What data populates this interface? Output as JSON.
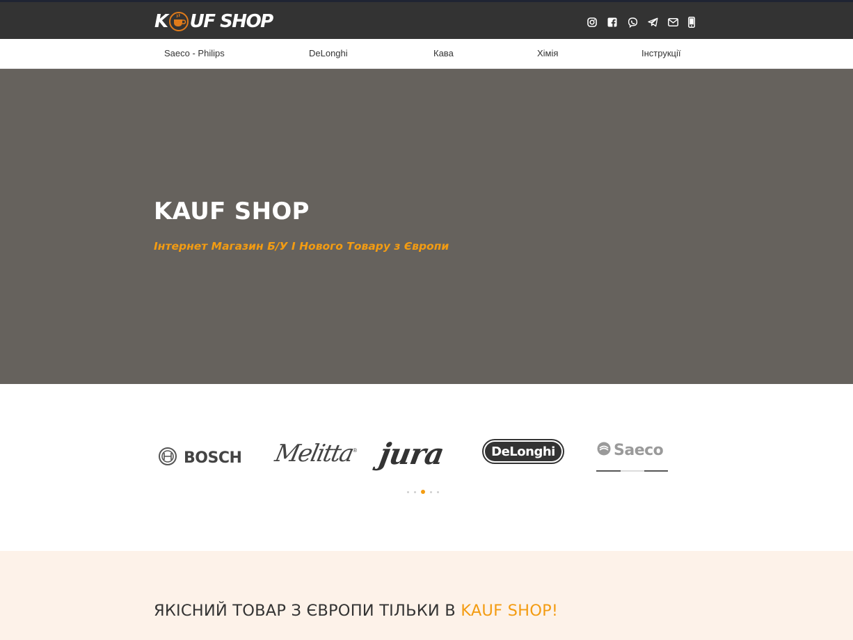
{
  "header": {
    "logo": {
      "part1": "K",
      "part2": "UF SHOP"
    },
    "socials": [
      {
        "name": "instagram-icon"
      },
      {
        "name": "facebook-icon"
      },
      {
        "name": "viber-icon"
      },
      {
        "name": "telegram-icon"
      },
      {
        "name": "email-icon"
      },
      {
        "name": "phone-icon"
      }
    ]
  },
  "nav": {
    "items": [
      "Saeco - Philips",
      "DeLonghi",
      "Кава",
      "Хімія",
      "Інструкції"
    ]
  },
  "hero": {
    "title": "KAUF SHOP",
    "subtitle": "Інтернет Магазин Б/У І Нового Товару з Європи"
  },
  "brands": {
    "logos": [
      "BOSCH",
      "Melitta",
      "jura",
      "DeLonghi",
      "Saeco"
    ],
    "carousel": {
      "total": 5,
      "active": 3
    }
  },
  "promo": {
    "title_prefix": "ЯКІСНИЙ ТОВАР З ЄВРОПИ ТІЛЬКИ В ",
    "title_accent": "KAUF SHOP!"
  },
  "colors": {
    "accent": "#f39c12",
    "topbar": "#333333",
    "hero_bg": "#66625d",
    "promo_bg": "#fdf2e9"
  }
}
